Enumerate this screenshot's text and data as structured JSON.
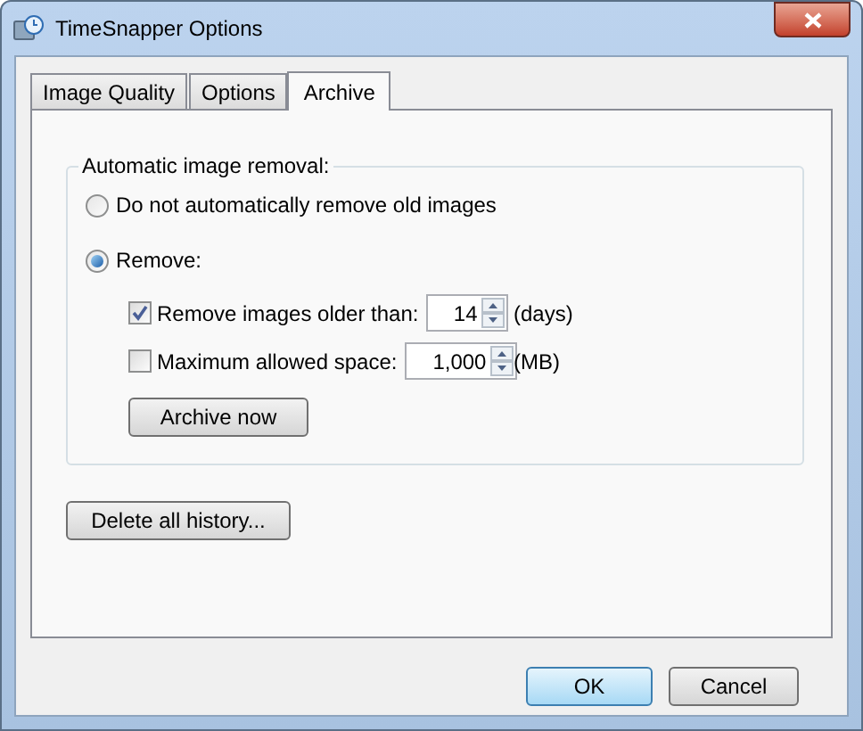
{
  "window": {
    "title": "TimeSnapper Options"
  },
  "tabs": [
    {
      "label": "Image Quality",
      "selected": false
    },
    {
      "label": "Options",
      "selected": false
    },
    {
      "label": "Archive",
      "selected": true
    }
  ],
  "group": {
    "title": "Automatic image removal:",
    "options": [
      {
        "label": "Do not automatically remove old images",
        "selected": false
      },
      {
        "label": "Remove:",
        "selected": true
      }
    ],
    "limits": [
      {
        "label": "Remove images older than:",
        "checked": true,
        "value": "14",
        "unit": "(days)"
      },
      {
        "label": "Maximum allowed space:",
        "checked": false,
        "value": "1,000",
        "unit": "(MB)"
      }
    ],
    "archive_button": "Archive now"
  },
  "delete_button": "Delete all history...",
  "buttons": [
    {
      "label": "OK",
      "default": true
    },
    {
      "label": "Cancel",
      "default": false
    }
  ]
}
